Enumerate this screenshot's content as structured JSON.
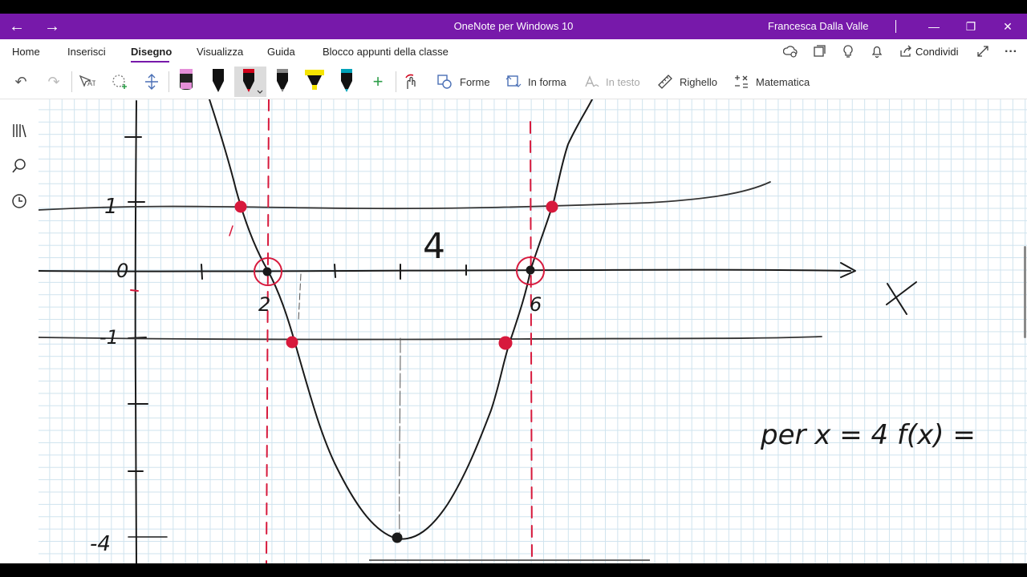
{
  "window": {
    "title": "OneNote per Windows 10",
    "user": "Francesca Dalla Valle",
    "back_icon": "←",
    "forward_icon": "→",
    "minimize_icon": "—",
    "restore_icon": "❐",
    "close_icon": "✕"
  },
  "menu": {
    "tabs": [
      {
        "label": "Home"
      },
      {
        "label": "Inserisci"
      },
      {
        "label": "Disegno"
      },
      {
        "label": "Visualizza"
      },
      {
        "label": "Guida"
      },
      {
        "label": "Blocco appunti della classe"
      }
    ],
    "active_tab": "Disegno",
    "share_label": "Condividi",
    "more_icon": "···"
  },
  "toolbar": {
    "undo_icon": "↶",
    "redo_icon": "↷",
    "shapes_label": "Forme",
    "ink_to_shape_label": "In forma",
    "ink_to_text_label": "In testo",
    "ruler_label": "Righello",
    "math_label": "Matematica",
    "add_pen_icon": "+",
    "pen_colors": [
      "#e48fd8",
      "#111111",
      "#d0021b",
      "#111111",
      "#f5e400",
      "#00a2b8"
    ]
  },
  "notes": {
    "colors": {
      "ink": "#1a1a1a",
      "red_ink": "#d7193c",
      "grid": "#cfe3ee"
    },
    "y_labels": [
      "1",
      "0",
      "-1",
      "-4"
    ],
    "x_labels": [
      "2",
      "6",
      "4"
    ],
    "axis_letter": "x",
    "formula": "per x = 4   f(x) ="
  }
}
